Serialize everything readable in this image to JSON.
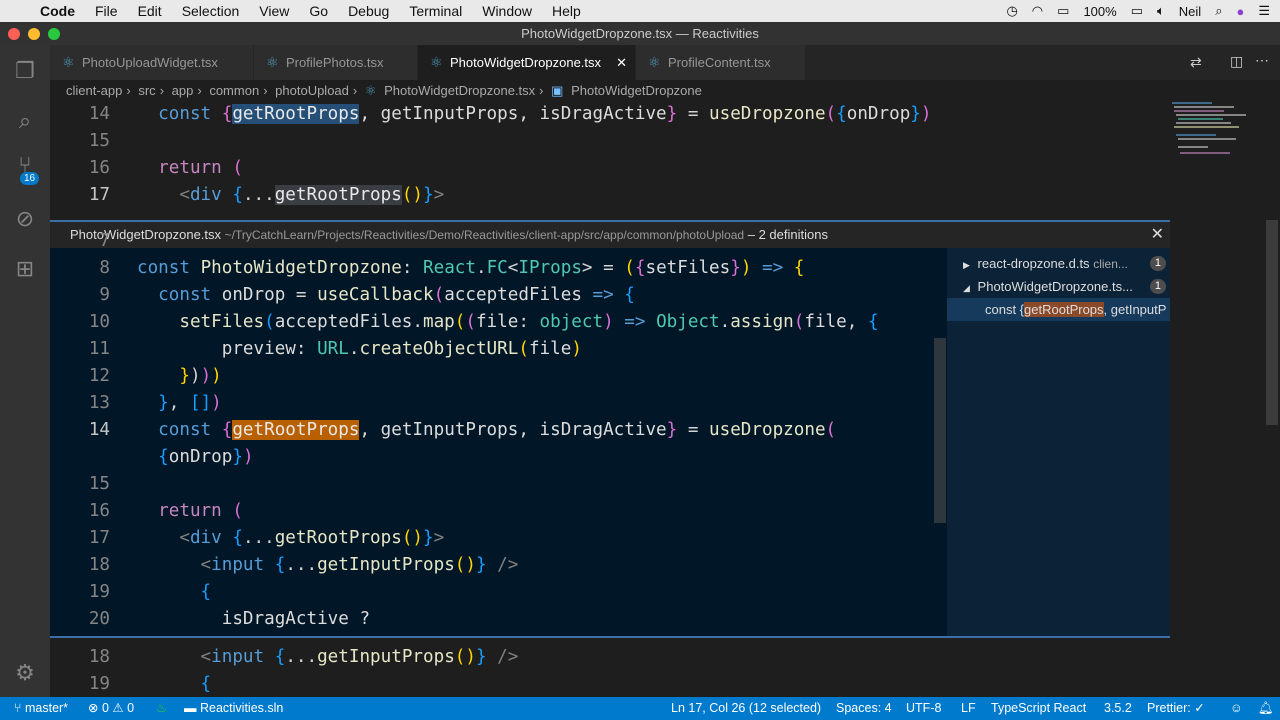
{
  "menubar": {
    "app": "Code",
    "items": [
      "File",
      "Edit",
      "Selection",
      "View",
      "Go",
      "Debug",
      "Terminal",
      "Window",
      "Help"
    ],
    "battery": "100%",
    "user": "Neil"
  },
  "window_title": "PhotoWidgetDropzone.tsx — Reactivities",
  "tabs": [
    {
      "label": "PhotoUploadWidget.tsx"
    },
    {
      "label": "ProfilePhotos.tsx"
    },
    {
      "label": "PhotoWidgetDropzone.tsx",
      "active": true
    },
    {
      "label": "ProfileContent.tsx"
    }
  ],
  "breadcrumb": [
    "client-app",
    "src",
    "app",
    "common",
    "photoUpload",
    "PhotoWidgetDropzone.tsx",
    "PhotoWidgetDropzone"
  ],
  "activity_badge": "16",
  "editor_top": [
    {
      "n": "14",
      "t": [
        [
          "  const ",
          "k"
        ],
        [
          "{",
          "b2"
        ],
        [
          "getRootProps",
          "hlb"
        ],
        [
          ", getInputProps, isDragActive",
          "v"
        ],
        [
          "}",
          "b2"
        ],
        [
          " = ",
          "p"
        ],
        [
          "useDropzone",
          "f"
        ],
        [
          "(",
          "b2"
        ],
        [
          "{",
          "b3"
        ],
        [
          "onDrop",
          "v"
        ],
        [
          "}",
          "b3"
        ],
        [
          ")",
          "b2"
        ]
      ]
    },
    {
      "n": "15",
      "t": []
    },
    {
      "n": "16",
      "t": [
        [
          "  return ",
          "r"
        ],
        [
          "(",
          "b2"
        ]
      ]
    },
    {
      "n": "17",
      "t": [
        [
          "    <",
          "g"
        ],
        [
          "div ",
          "k"
        ],
        [
          "{",
          "b3"
        ],
        [
          "...",
          "p"
        ],
        [
          "getRootProps",
          "hlg"
        ],
        [
          "(",
          "b1"
        ],
        [
          ")",
          "b1"
        ],
        [
          "}",
          "b3"
        ],
        [
          ">",
          "g"
        ]
      ]
    }
  ],
  "peek": {
    "file": "PhotoWidgetDropzone.tsx",
    "path": "~/TryCatchLearn/Projects/Reactivities/Demo/Reactivities/client-app/src/app/common/photoUpload",
    "summary": "– 2 definitions",
    "lines": [
      {
        "n": "7",
        "t": []
      },
      {
        "n": "8",
        "t": [
          [
            "const ",
            "k"
          ],
          [
            "PhotoWidgetDropzone",
            "f"
          ],
          [
            ": ",
            "p"
          ],
          [
            "React",
            "t"
          ],
          [
            ".",
            "p"
          ],
          [
            "FC",
            "t"
          ],
          [
            "<",
            "p"
          ],
          [
            "IProps",
            "t"
          ],
          [
            "> = ",
            "p"
          ],
          [
            "(",
            "b1"
          ],
          [
            "{",
            "b2"
          ],
          [
            "setFiles",
            "v"
          ],
          [
            "}",
            "b2"
          ],
          [
            ")",
            "b1"
          ],
          [
            " => ",
            "k"
          ],
          [
            "{",
            "b1"
          ]
        ]
      },
      {
        "n": "9",
        "t": [
          [
            "  const ",
            "k"
          ],
          [
            "onDrop",
            "v"
          ],
          [
            " = ",
            "p"
          ],
          [
            "useCallback",
            "f"
          ],
          [
            "(",
            "b2"
          ],
          [
            "acceptedFiles",
            "v"
          ],
          [
            " => ",
            "k"
          ],
          [
            "{",
            "b3"
          ]
        ]
      },
      {
        "n": "10",
        "t": [
          [
            "    setFiles",
            "f"
          ],
          [
            "(",
            "b3"
          ],
          [
            "acceptedFiles",
            "v"
          ],
          [
            ".",
            "p"
          ],
          [
            "map",
            "f"
          ],
          [
            "(",
            "b1"
          ],
          [
            "(",
            "b2"
          ],
          [
            "file",
            "v"
          ],
          [
            ": ",
            "p"
          ],
          [
            "object",
            "t"
          ],
          [
            ")",
            "b2"
          ],
          [
            " => ",
            "k"
          ],
          [
            "Object",
            "t"
          ],
          [
            ".",
            "p"
          ],
          [
            "assign",
            "f"
          ],
          [
            "(",
            "b2"
          ],
          [
            "file",
            "v"
          ],
          [
            ", ",
            "p"
          ],
          [
            "{",
            "b3"
          ]
        ]
      },
      {
        "n": "11",
        "t": [
          [
            "        preview",
            "v"
          ],
          [
            ": ",
            "p"
          ],
          [
            "URL",
            "t"
          ],
          [
            ".",
            "p"
          ],
          [
            "createObjectURL",
            "f"
          ],
          [
            "(",
            "b1"
          ],
          [
            "file",
            "v"
          ],
          [
            ")",
            "b1"
          ]
        ]
      },
      {
        "n": "12",
        "t": [
          [
            "    }",
            "b1"
          ],
          [
            ")",
            "p"
          ],
          [
            ")",
            "b2"
          ],
          [
            ")",
            "b1"
          ]
        ]
      },
      {
        "n": "13",
        "t": [
          [
            "  }",
            "b3"
          ],
          [
            ", ",
            "p"
          ],
          [
            "[",
            "b3"
          ],
          [
            "]",
            "b3"
          ],
          [
            ")",
            "b2"
          ]
        ]
      },
      {
        "n": "14",
        "t": [
          [
            "  const ",
            "k"
          ],
          [
            "{",
            "b2"
          ],
          [
            "getRootProps",
            "hlo"
          ],
          [
            ", getInputProps, isDragActive",
            "v"
          ],
          [
            "}",
            "b2"
          ],
          [
            " = ",
            "p"
          ],
          [
            "useDropzone",
            "f"
          ],
          [
            "(",
            "b2"
          ]
        ]
      },
      {
        "n": "",
        "t": [
          [
            "  {",
            "b3"
          ],
          [
            "onDrop",
            "v"
          ],
          [
            "}",
            "b3"
          ],
          [
            ")",
            "b2"
          ]
        ]
      },
      {
        "n": "15",
        "t": []
      },
      {
        "n": "16",
        "t": [
          [
            "  return ",
            "r"
          ],
          [
            "(",
            "b2"
          ]
        ]
      },
      {
        "n": "17",
        "t": [
          [
            "    <",
            "g"
          ],
          [
            "div ",
            "k"
          ],
          [
            "{",
            "b3"
          ],
          [
            "...",
            "p"
          ],
          [
            "getRootProps",
            "f"
          ],
          [
            "(",
            "b1"
          ],
          [
            ")",
            "b1"
          ],
          [
            "}",
            "b3"
          ],
          [
            ">",
            "g"
          ]
        ]
      },
      {
        "n": "18",
        "t": [
          [
            "      <",
            "g"
          ],
          [
            "input ",
            "k"
          ],
          [
            "{",
            "b3"
          ],
          [
            "...",
            "p"
          ],
          [
            "getInputProps",
            "f"
          ],
          [
            "()",
            "b1"
          ],
          [
            "}",
            "b3"
          ],
          [
            " />",
            "g"
          ]
        ]
      },
      {
        "n": "19",
        "t": [
          [
            "      {",
            "b3"
          ]
        ]
      },
      {
        "n": "20",
        "t": [
          [
            "        isDragActive ?",
            "v"
          ]
        ]
      }
    ],
    "refs": [
      {
        "label": "react-dropzone.d.ts",
        "detail": "clien...",
        "count": "1"
      },
      {
        "label": "PhotoWidgetDropzone.ts...",
        "count": "1"
      },
      {
        "pre": "const {",
        "match": "getRootProps",
        "post": ", getInputP"
      }
    ]
  },
  "editor_bottom": [
    {
      "n": "18",
      "t": [
        [
          "      <",
          "g"
        ],
        [
          "input ",
          "k"
        ],
        [
          "{",
          "b3"
        ],
        [
          "...",
          "p"
        ],
        [
          "getInputProps",
          "f"
        ],
        [
          "()",
          "b1"
        ],
        [
          "}",
          "b3"
        ],
        [
          " />",
          "g"
        ]
      ]
    },
    {
      "n": "19",
      "t": [
        [
          "      {",
          "b3"
        ]
      ]
    }
  ],
  "status": {
    "branch": "master*",
    "errors": "0",
    "warnings": "0",
    "solution": "Reactivities.sln",
    "position": "Ln 17, Col 26 (12 selected)",
    "spaces": "Spaces: 4",
    "encoding": "UTF-8",
    "eol": "LF",
    "language": "TypeScript React",
    "version": "3.5.2",
    "prettier": "Prettier: ✓"
  },
  "colors": {
    "accent": "#007acc",
    "peek_bg": "#011627",
    "selection": "#b86000"
  }
}
